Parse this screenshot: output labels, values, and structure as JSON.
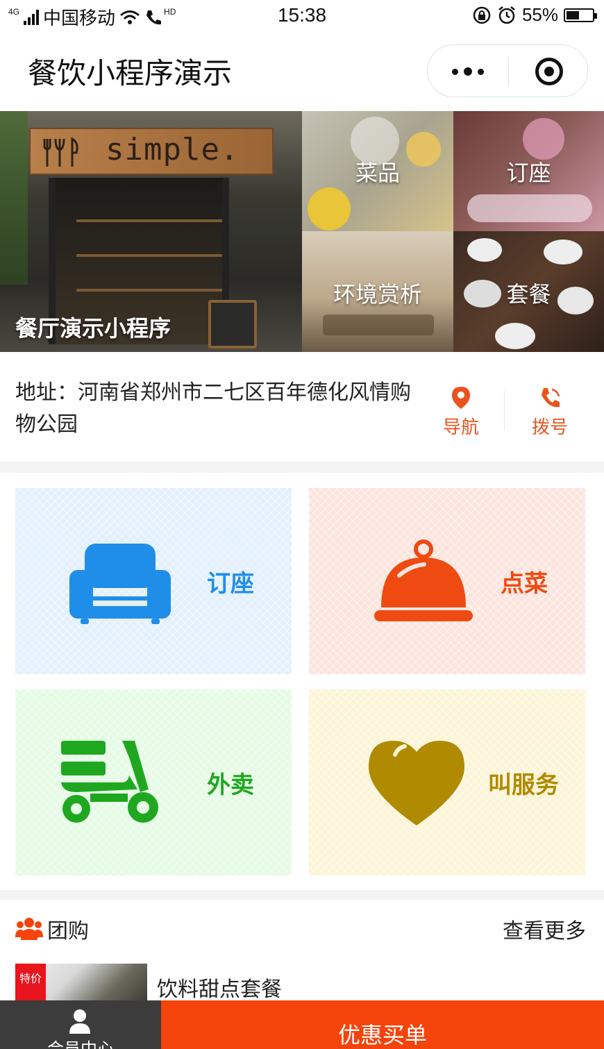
{
  "status_bar": {
    "network_tag": "4G",
    "carrier": "中国移动",
    "hd_tag": "HD",
    "time": "15:38",
    "battery_text": "55%",
    "battery_level": 0.55
  },
  "nav_bar": {
    "title": "餐饮小程序演示",
    "more_icon": "more-dots-icon",
    "close_icon": "target-circle-icon"
  },
  "banner": {
    "main": {
      "sign_text": "simple.",
      "label": "餐厅演示小程序"
    },
    "tiles": [
      {
        "key": "dishes",
        "label": "菜品"
      },
      {
        "key": "seat",
        "label": "订座"
      },
      {
        "key": "env",
        "label": "环境赏析"
      },
      {
        "key": "set",
        "label": "套餐"
      }
    ]
  },
  "address": {
    "text": "地址：河南省郑州市二七区百年德化风情购物公园",
    "nav_label": "导航",
    "call_label": "拨号",
    "accent_color": "#e8541e"
  },
  "features": [
    {
      "key": "seat",
      "label": "订座",
      "icon": "sofa-icon",
      "color": "#1f8ee8"
    },
    {
      "key": "order",
      "label": "点菜",
      "icon": "food-cloche-icon",
      "color": "#ef4a12"
    },
    {
      "key": "delivery",
      "label": "外卖",
      "icon": "scooter-icon",
      "color": "#1fa81f"
    },
    {
      "key": "service",
      "label": "叫服务",
      "icon": "heart-icon",
      "color": "#b08a00"
    }
  ],
  "group_buy": {
    "title": "团购",
    "more": "查看更多",
    "items": [
      {
        "tag": "特价",
        "name": "饮料甜点套餐"
      }
    ]
  },
  "bottom_bar": {
    "member_label": "会员中心",
    "pay_label": "优惠买单",
    "pay_color": "#f5430c"
  }
}
